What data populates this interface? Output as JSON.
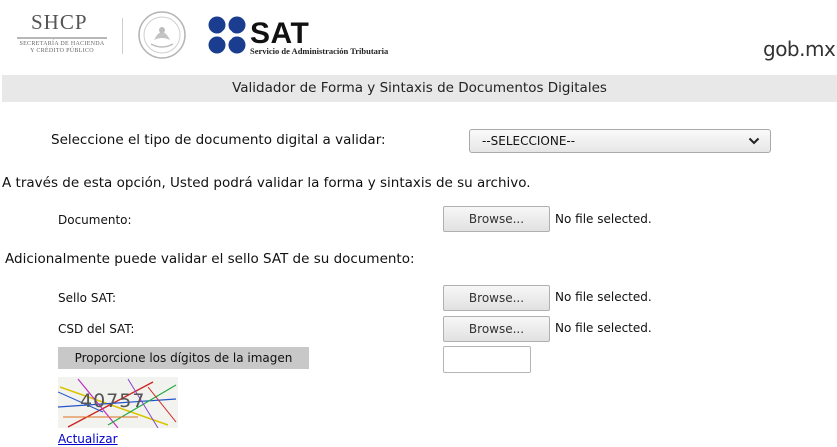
{
  "header": {
    "shcp": "SHCP",
    "shcp_sub_line1": "SECRETARÍA DE HACIENDA",
    "shcp_sub_line2": "Y CRÉDITO PÚBLICO",
    "sat_name": "SAT",
    "sat_sub": "Servicio de Administración Tributaria",
    "gob": "gob.mx"
  },
  "page": {
    "title": "Validador de Forma y Sintaxis de Documentos Digitales",
    "select_label": "Seleccione el tipo de documento digital a validar:",
    "select_value": "--SELECCIONE--",
    "intro": "A través de esta opción, Usted podrá validar la forma y sintaxis de su archivo.",
    "documento_label": "Documento:",
    "additional": "Adicionalmente puede validar el sello SAT de su documento:",
    "sello_label": "Sello SAT:",
    "csd_label": "CSD del SAT:",
    "browse": "Browse...",
    "no_file": "No file selected.",
    "captcha_label": "Proporcione los dígitos de la imagen",
    "captcha_value": "",
    "captcha_digits": "40757",
    "refresh": "Actualizar"
  },
  "colors": {
    "sat_blue": "#1a3d8f",
    "title_bar": "#e8e8e8",
    "captcha_bar": "#c8c8c8",
    "link": "#0000cc"
  }
}
